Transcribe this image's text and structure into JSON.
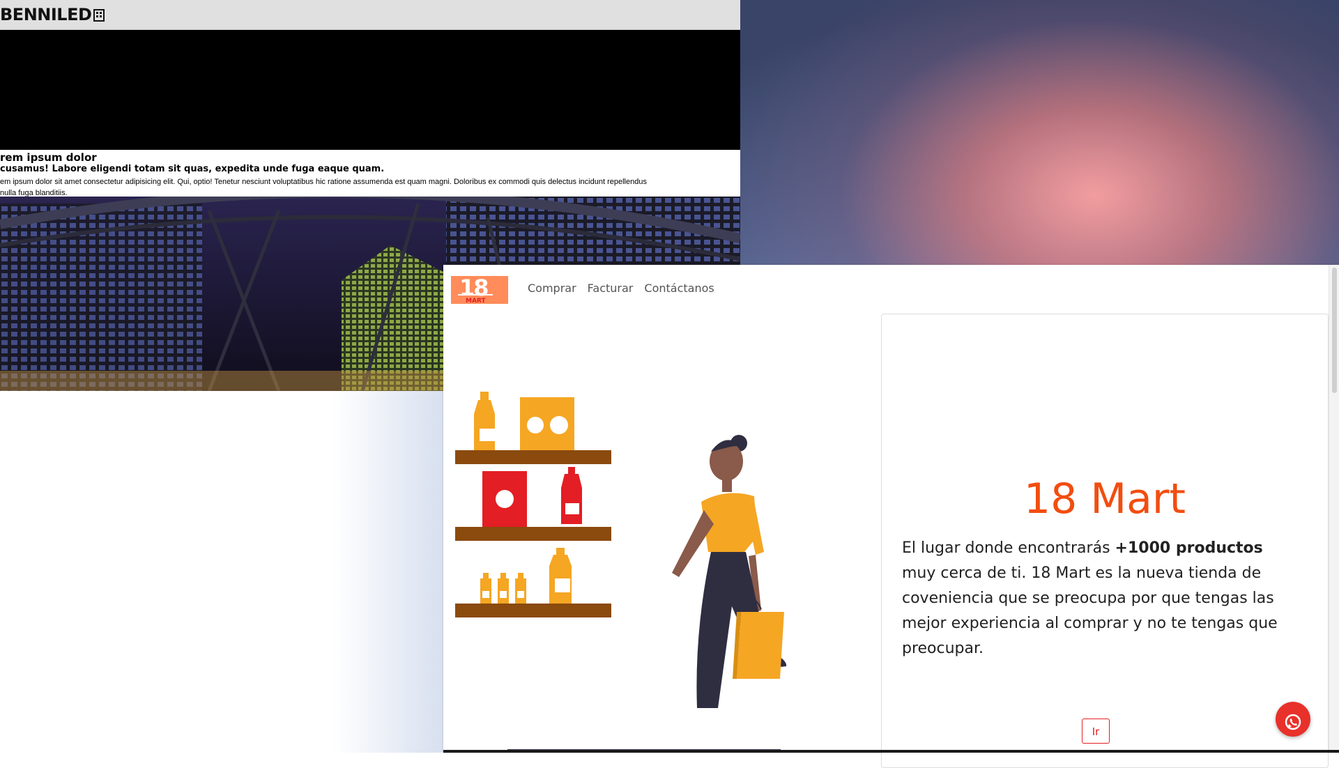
{
  "back_window": {
    "logo_text": "BENNILED",
    "heading": "rem ipsum dolor",
    "subheading": "cusamus! Labore eligendi totam sit quas, expedita unde fuga eaque quam.",
    "paragraph_line1": "em ipsum dolor sit amet consectetur adipisicing elit. Qui, optio! Tenetur nesciunt voluptatibus hic ratione assumenda est quam magni. Doloribus ex commodi quis delectus incidunt repellendus",
    "paragraph_line2": "nulla fuga blanditiis."
  },
  "front_window": {
    "brand": {
      "number": "18",
      "name": "MART"
    },
    "nav": [
      "Comprar",
      "Facturar",
      "Contáctanos"
    ],
    "hero": {
      "title": "18 Mart",
      "desc_before": "El lugar donde encontrarás ",
      "desc_bold": "+1000 productos",
      "desc_after": " muy cerca de ti. 18 Mart es la nueva tienda de coveniencia que se preocupa por que tengas las mejor experiencia al comprar y no te tengas que preocupar.",
      "button_label": "Ir"
    }
  },
  "colors": {
    "brand_orange": "#ff8c5a",
    "title_orange": "#f24d0f",
    "brand_red": "#e31e24",
    "whatsapp_button": "#e8312a"
  },
  "icons": {
    "whatsapp": "whatsapp-icon"
  }
}
